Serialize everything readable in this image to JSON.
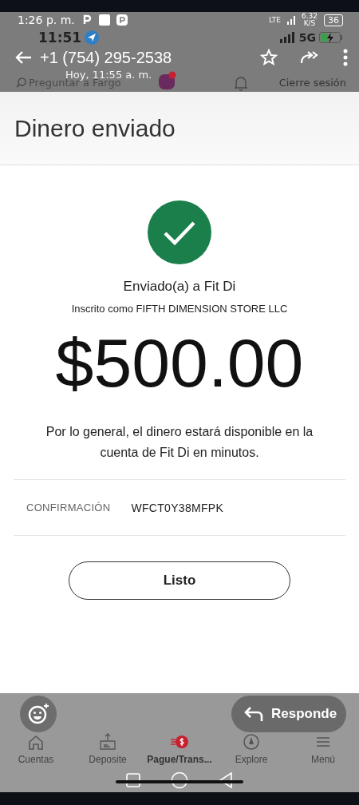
{
  "status_bar": {
    "time": "1:26 p. m.",
    "network": "LTE",
    "speed": "6.32",
    "speed_unit": "K/S",
    "battery": "36"
  },
  "message_overlay": {
    "time": "11:51",
    "network": "5G",
    "contact": "+1 (754) 295-2538",
    "date": "Hoy, 11:55 a. m.",
    "reply_button": "Responde"
  },
  "app_header": {
    "search": {
      "placeholder": "Preguntar a Fargo"
    },
    "logout": "Cierre sesión"
  },
  "page_title": "Dinero enviado",
  "confirmation": {
    "recipient": "Enviado(a) a Fit Di",
    "enrolled_as": "Inscrito como FIFTH DIMENSION STORE LLC",
    "amount": "$500.00",
    "note": "Por lo general, el dinero estará disponible en la cuenta de Fit Di en minutos.",
    "label": "CONFIRMACIÓN",
    "code": "WFCT0Y38MFPK"
  },
  "done_button": "Listo",
  "bottom_nav": [
    {
      "label": "Cuentas",
      "selected": false
    },
    {
      "label": "Deposite",
      "selected": false
    },
    {
      "label": "Pague/Trans...",
      "selected": true
    },
    {
      "label": "Explore",
      "selected": false
    },
    {
      "label": "Menú",
      "selected": false
    }
  ]
}
